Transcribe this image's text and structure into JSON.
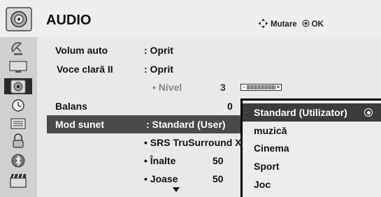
{
  "header": {
    "title": "AUDIO",
    "nav_icon": "four-way-arrows-icon",
    "nav_label": "Mutare",
    "ok_icon": "ok-button-icon",
    "ok_label": "OK"
  },
  "sidebar": {
    "items": [
      {
        "name": "sidebar-item-setup",
        "icon": "satellite-dish-icon",
        "active": false
      },
      {
        "name": "sidebar-item-picture",
        "icon": "tv-screen-icon",
        "active": false
      },
      {
        "name": "sidebar-item-audio",
        "icon": "speaker-icon",
        "active": true
      },
      {
        "name": "sidebar-item-time",
        "icon": "clock-icon",
        "active": false
      },
      {
        "name": "sidebar-item-option",
        "icon": "options-icon",
        "active": false
      },
      {
        "name": "sidebar-item-lock",
        "icon": "lock-icon",
        "active": false
      },
      {
        "name": "sidebar-item-network",
        "icon": "bluetooth-icon",
        "active": false
      },
      {
        "name": "sidebar-item-movie",
        "icon": "clapperboard-icon",
        "active": false
      }
    ]
  },
  "menu": {
    "rows": [
      {
        "label": "Volum auto",
        "value": ": Oprit"
      },
      {
        "label": "Voce clară II",
        "value": ": Oprit"
      },
      {
        "sublabel": "• Nivel",
        "number": "3",
        "slider_minus": "-",
        "slider_plus": "+"
      },
      {
        "label": "Balans",
        "number": "0"
      },
      {
        "label": "Mod sunet",
        "value": ": Standard (User)",
        "selected": true
      },
      {
        "sublabel": "• SRS TruSurround XT"
      },
      {
        "sublabel": "• Înalte",
        "number": "50"
      },
      {
        "sublabel": "• Joase",
        "number": "50"
      }
    ],
    "more_icon": "down-arrow-icon"
  },
  "popup": {
    "options": [
      {
        "label": "Standard (Utilizator)",
        "selected": true
      },
      {
        "label": "muzică"
      },
      {
        "label": "Cinema"
      },
      {
        "label": "Sport"
      },
      {
        "label": "Joc"
      }
    ]
  }
}
